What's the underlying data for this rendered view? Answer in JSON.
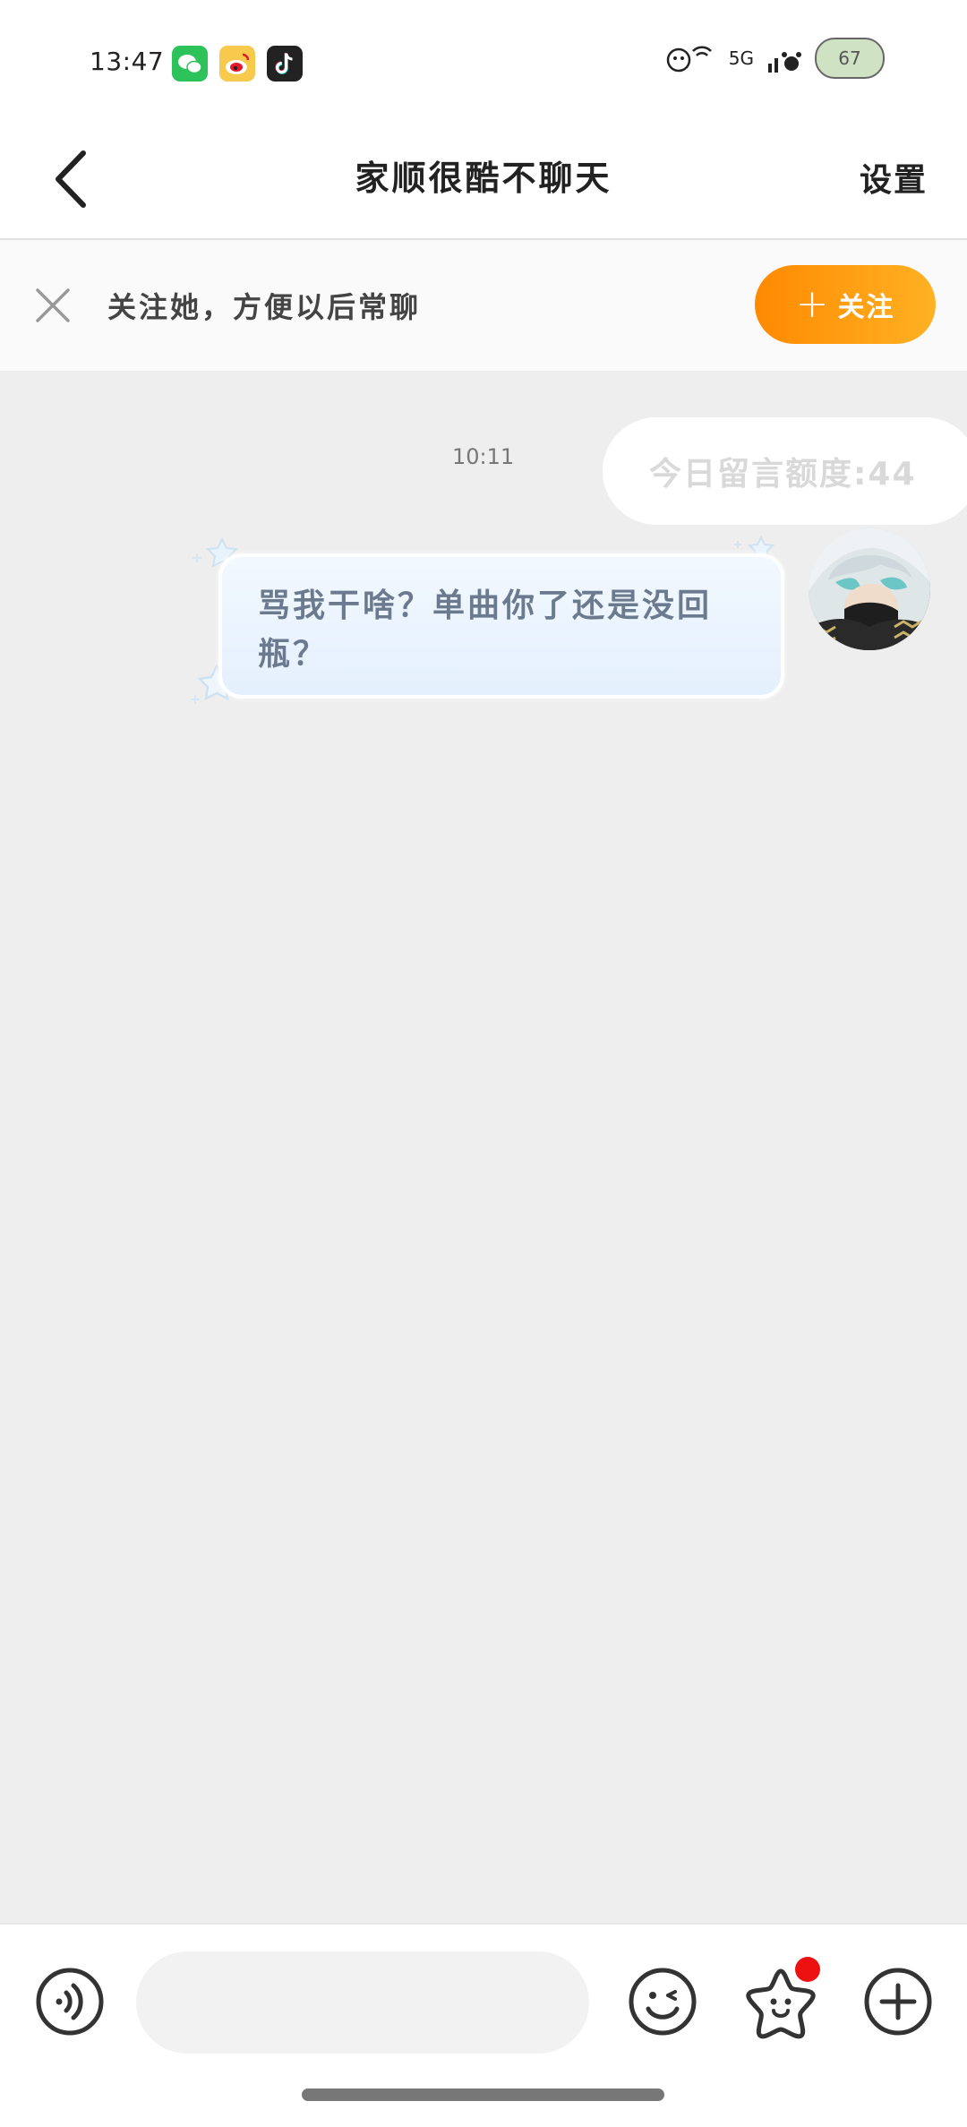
{
  "status_bar": {
    "time": "13:47",
    "apps": [
      "wechat-icon",
      "weibo-icon",
      "tiktok-icon"
    ],
    "network": "5G",
    "battery": "67"
  },
  "nav": {
    "title": "家顺很酷不聊天",
    "settings_label": "设置"
  },
  "follow_banner": {
    "tip": "关注她，方便以后常聊",
    "button_label": "关注",
    "button_color": "#ff9a0a"
  },
  "chat": {
    "timestamp": "10:11",
    "quota_text": "今日留言额度:44",
    "messages": [
      {
        "text": "骂我干啥？单曲你了还是没回瓶？",
        "side": "right"
      }
    ]
  },
  "input_bar": {
    "placeholder": "",
    "sticker_badge_color": "#ee1111"
  }
}
